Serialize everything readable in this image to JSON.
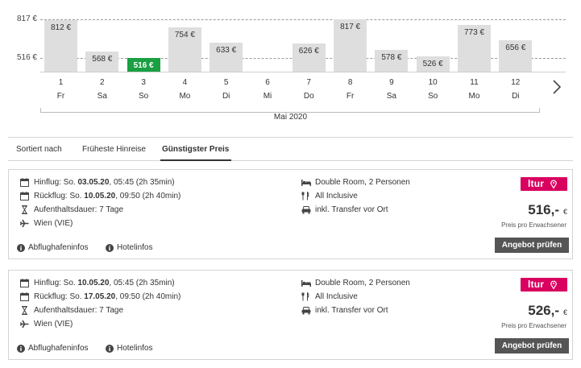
{
  "chart_data": {
    "type": "bar",
    "y_ticks": [
      "817 €",
      "516 €"
    ],
    "selected_index": 2,
    "days": [
      {
        "day": "1",
        "weekday": "Fr",
        "label": "812 €",
        "value": 812
      },
      {
        "day": "2",
        "weekday": "Sa",
        "label": "568 €",
        "value": 568
      },
      {
        "day": "3",
        "weekday": "So",
        "label": "516 €",
        "value": 516
      },
      {
        "day": "4",
        "weekday": "Mo",
        "label": "754 €",
        "value": 754
      },
      {
        "day": "5",
        "weekday": "Di",
        "label": "633 €",
        "value": 633
      },
      {
        "day": "6",
        "weekday": "Mi",
        "label": "",
        "value": null
      },
      {
        "day": "7",
        "weekday": "Do",
        "label": "626 €",
        "value": 626
      },
      {
        "day": "8",
        "weekday": "Fr",
        "label": "817 €",
        "value": 817
      },
      {
        "day": "9",
        "weekday": "Sa",
        "label": "578 €",
        "value": 578
      },
      {
        "day": "10",
        "weekday": "So",
        "label": "526 €",
        "value": 526
      },
      {
        "day": "11",
        "weekday": "Mo",
        "label": "773 €",
        "value": 773
      },
      {
        "day": "12",
        "weekday": "Di",
        "label": "656 €",
        "value": 656
      }
    ],
    "month_label": "Mai 2020",
    "ylim": [
      340,
      817
    ]
  },
  "sort": {
    "label": "Sortiert nach",
    "earliest": "Früheste Hinreise",
    "cheapest": "Günstigster Preis"
  },
  "offers": [
    {
      "outbound_prefix": "Hinflug: So. ",
      "outbound_date": "03.05.20",
      "outbound_suffix": ", 05:45 (2h 35min)",
      "return_prefix": "Rückflug: So. ",
      "return_date": "10.05.20",
      "return_suffix": ", 09:50 (2h 40min)",
      "duration": "Aufenthaltsdauer: 7 Tage",
      "airport": "Wien (VIE)",
      "room": "Double Room, 2 Personen",
      "board": "All Inclusive",
      "transfer": "inkl. Transfer vor Ort",
      "airport_info": "Abflughafeninfos",
      "hotel_info": "Hotelinfos",
      "provider": "ltur",
      "price": "516,-",
      "currency": "€",
      "price_note": "Preis pro Erwachsener",
      "cta": "Angebot prüfen"
    },
    {
      "outbound_prefix": "Hinflug: So. ",
      "outbound_date": "10.05.20",
      "outbound_suffix": ", 05:45 (2h 35min)",
      "return_prefix": "Rückflug: So. ",
      "return_date": "17.05.20",
      "return_suffix": ", 09:50 (2h 40min)",
      "duration": "Aufenthaltsdauer: 7 Tage",
      "airport": "Wien (VIE)",
      "room": "Double Room, 2 Personen",
      "board": "All Inclusive",
      "transfer": "inkl. Transfer vor Ort",
      "airport_info": "Abflughafeninfos",
      "hotel_info": "Hotelinfos",
      "provider": "ltur",
      "price": "526,-",
      "currency": "€",
      "price_note": "Preis pro Erwachsener",
      "cta": "Angebot prüfen"
    }
  ],
  "colors": {
    "selected_bar": "#1a9f42",
    "bar": "#dedede",
    "provider_brand": "#d9005f",
    "button": "#555555"
  }
}
